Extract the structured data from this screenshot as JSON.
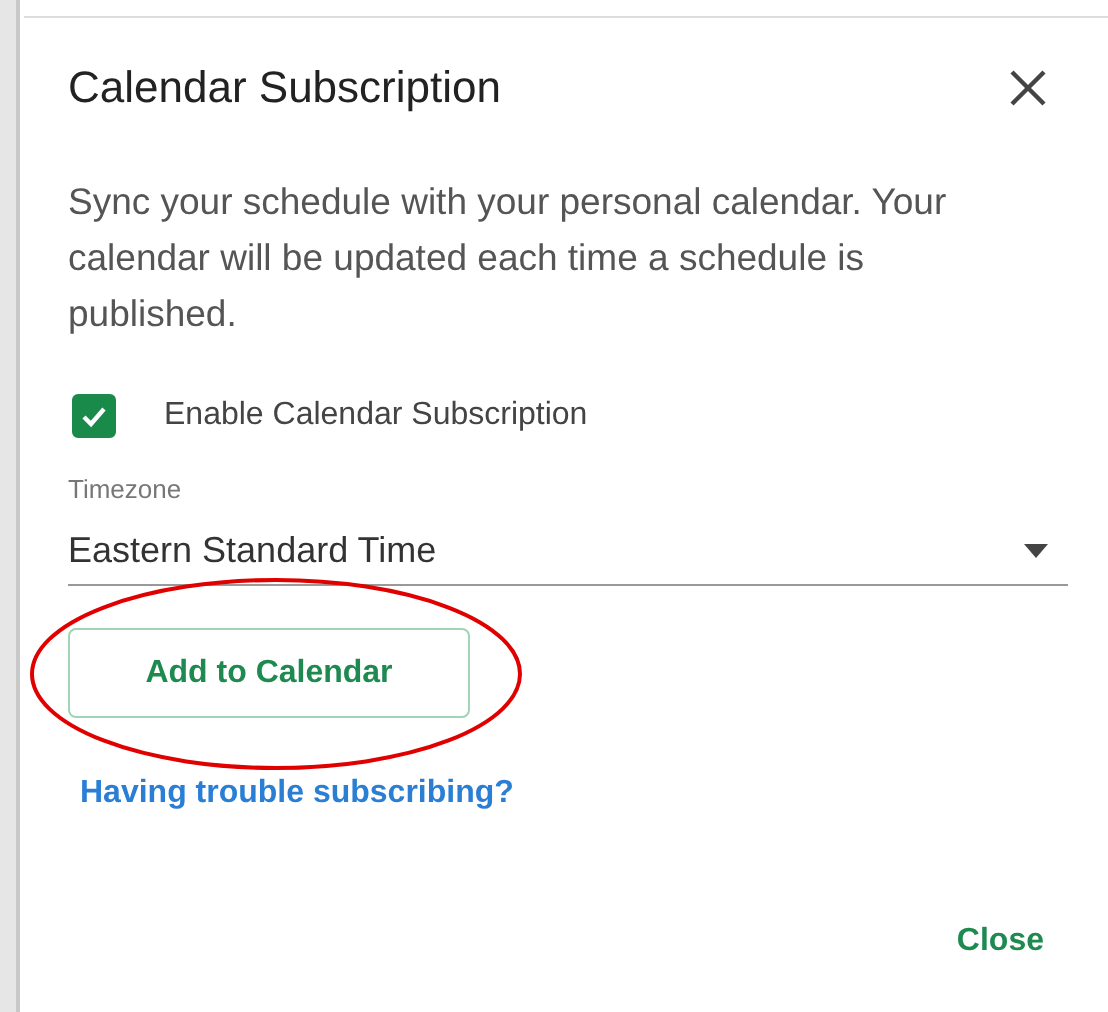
{
  "dialog": {
    "title": "Calendar Subscription",
    "description": "Sync your schedule with your personal calendar. Your calendar will be updated each time a schedule is published.",
    "checkbox": {
      "label": "Enable Calendar Subscription",
      "checked": true
    },
    "timezone": {
      "label": "Timezone",
      "value": "Eastern Standard Time"
    },
    "add_button": "Add to Calendar",
    "help_link": "Having trouble subscribing?",
    "close_button": "Close"
  }
}
